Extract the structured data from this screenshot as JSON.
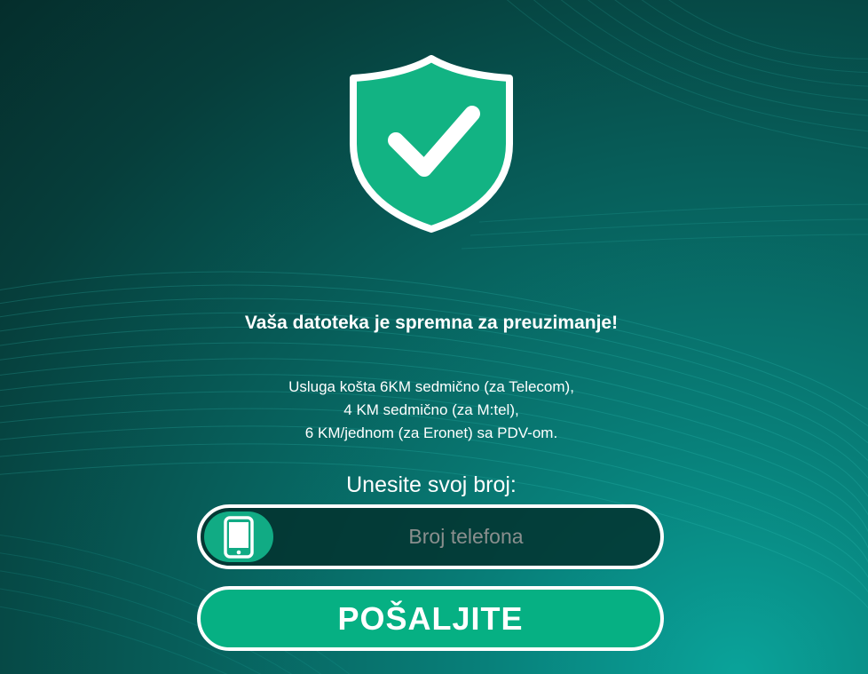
{
  "headline": "Vaša datoteka je spremna za preuzimanje!",
  "pricing_lines": [
    "Usluga košta 6KM sedmično (za Telecom),",
    "4 KM sedmično (za M:tel),",
    "6 KM/jednom (za Eronet) sa PDV-om."
  ],
  "prompt": "Unesite svoj broj:",
  "phone_input": {
    "placeholder": "Broj telefona",
    "value": "",
    "icon": "smartphone-icon"
  },
  "submit_label": "POŠALJITE",
  "colors": {
    "accent_green": "#06b083",
    "shield_green": "#12b383",
    "background_dark": "#052e2c",
    "background_teal": "#0aa39a"
  }
}
